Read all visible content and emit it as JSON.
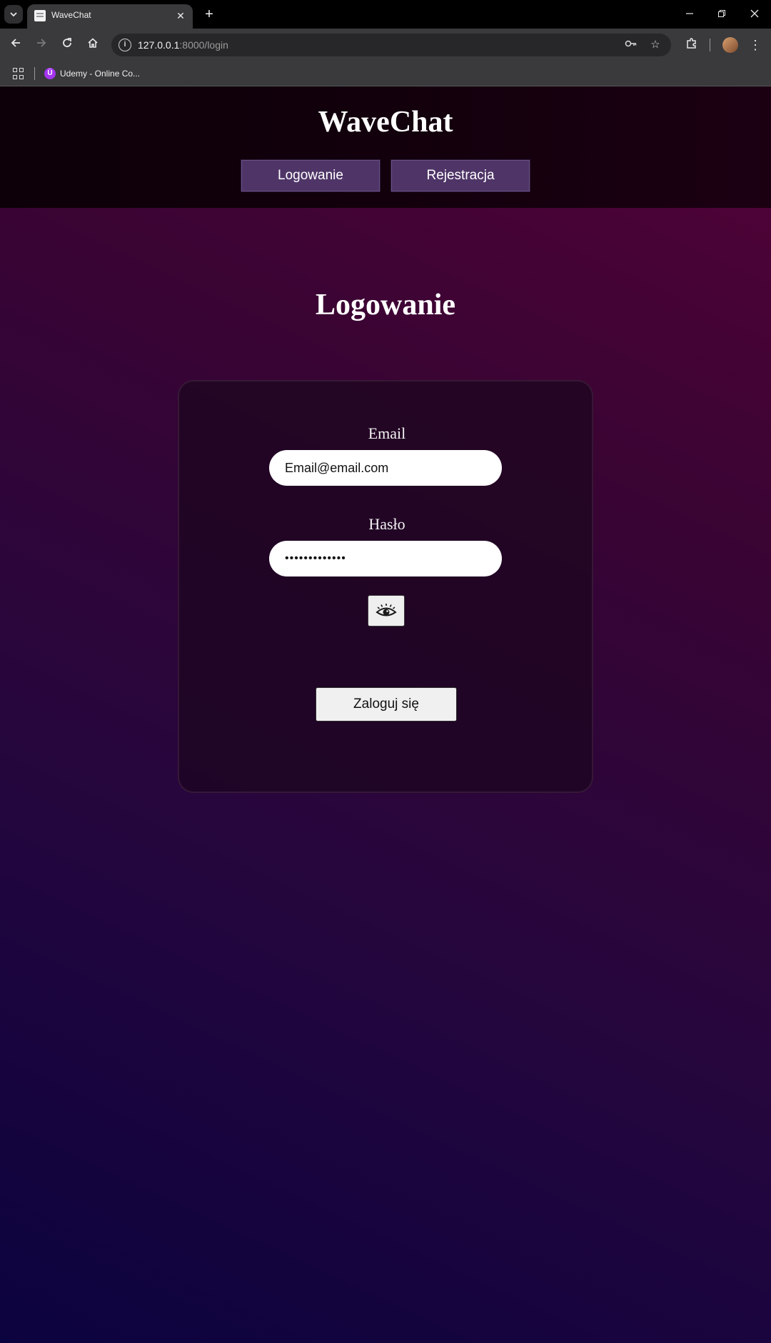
{
  "browser": {
    "tab_title": "WaveChat",
    "url_host": "127.0.0.1",
    "url_rest": ":8000/login",
    "bookmark_label": "Udemy - Online Co..."
  },
  "header": {
    "site_title": "WaveChat",
    "nav": {
      "login": "Logowanie",
      "register": "Rejestracja"
    }
  },
  "main": {
    "heading": "Logowanie",
    "form": {
      "email_label": "Email",
      "email_value": "Email@email.com",
      "password_label": "Hasło",
      "password_value": "•••••••••••••",
      "submit_label": "Zaloguj się"
    }
  },
  "colors": {
    "header_bg": "#12000c",
    "nav_button_bg": "#4f3567",
    "card_bg": "#1c061e"
  },
  "icons": {
    "show_password": "eye-icon"
  }
}
